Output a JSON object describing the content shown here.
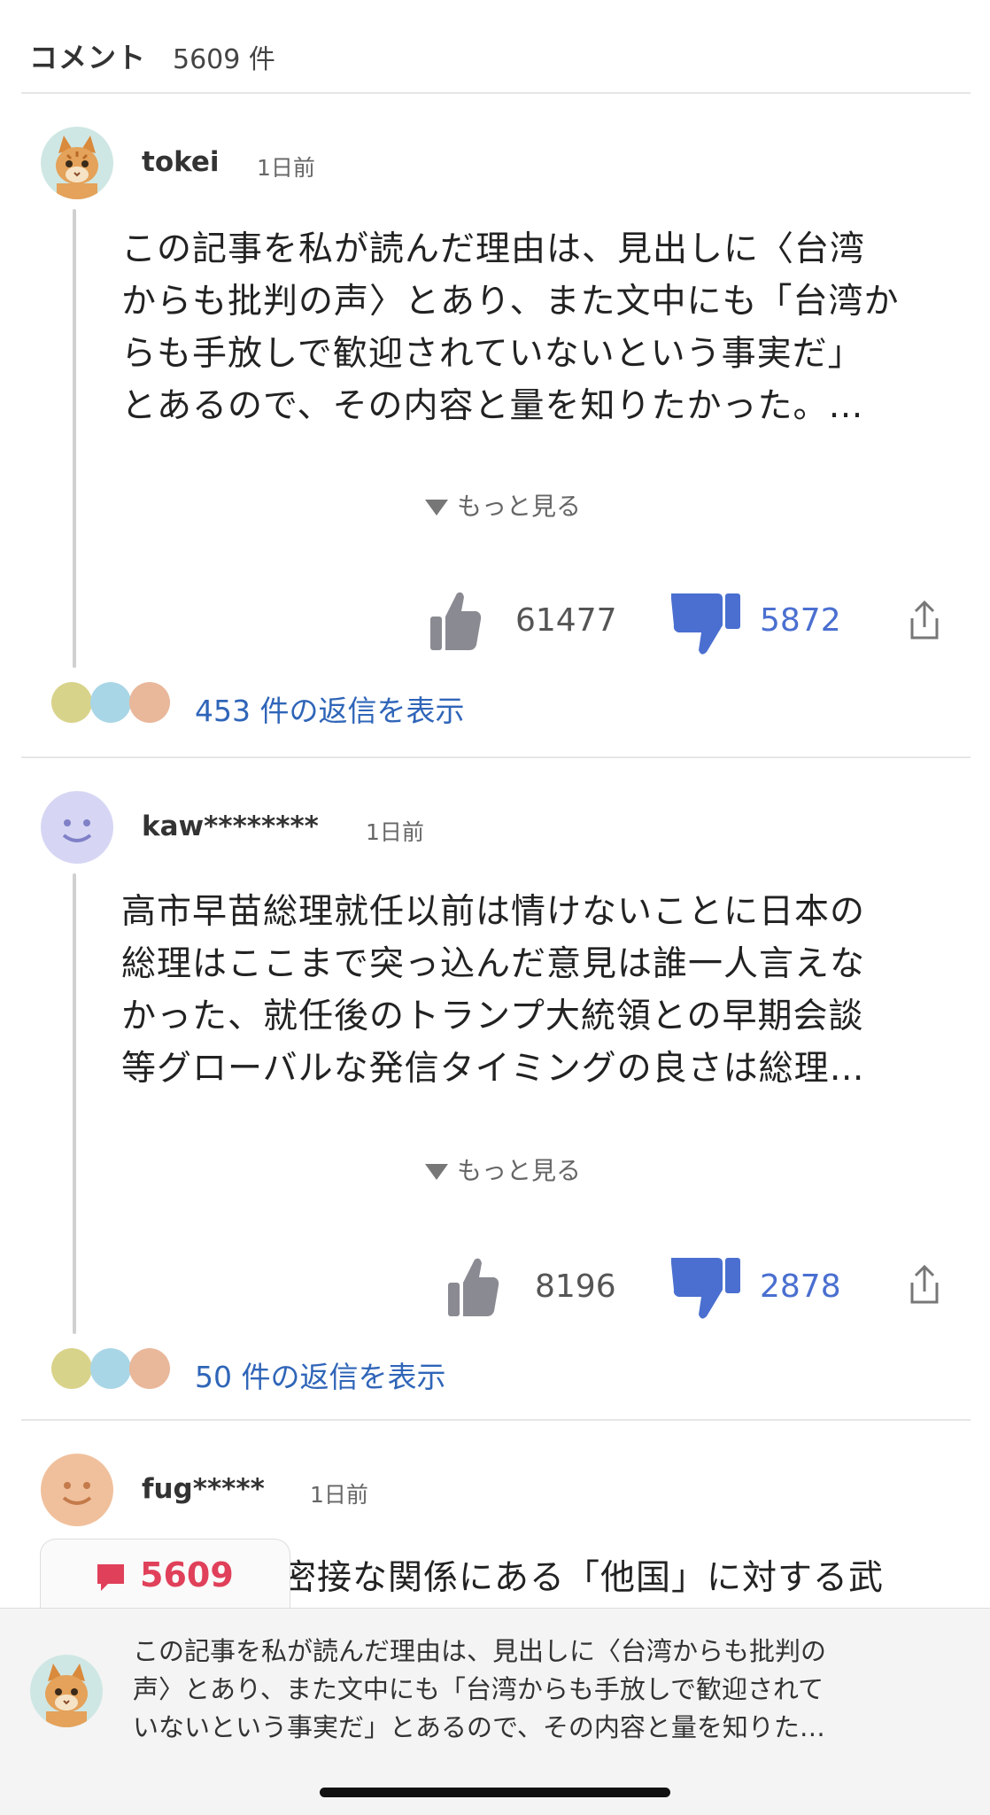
{
  "header": {
    "title": "コメント",
    "count": "5609 件"
  },
  "comments": [
    {
      "username": "tokei",
      "time": "1日前",
      "lines": [
        "この記事を私が読んだ理由は、見出しに〈台湾",
        "からも批判の声〉とあり、また文中にも「台湾か",
        "らも手放しで歓迎されていないという事実だ」",
        "とあるので、その内容と量を知りたかった。…"
      ],
      "more_label": "もっと見る",
      "likes": "61477",
      "dislikes": "5872",
      "replies_label": "453 件の返信を表示",
      "avatar_icon": "cat-avatar-icon"
    },
    {
      "username": "kaw********",
      "time": "1日前",
      "lines": [
        "高市早苗総理就任以前は情けないことに日本の",
        "総理はここまで突っ込んだ意見は誰一人言えな",
        "かった、就任後のトランプ大統領との早期会談",
        "等グローバルな発信タイミングの良さは総理…"
      ],
      "more_label": "もっと見る",
      "likes": "8196",
      "dislikes": "2878",
      "replies_label": "50 件の返信を表示",
      "avatar_icon": "smiley-avatar-icon"
    },
    {
      "username": "fug*****",
      "time": "1日前",
      "partial_line": "密接な関係にある「他国」に対する武",
      "avatar_icon": "smiley-avatar-icon"
    }
  ],
  "bottom_tab": {
    "count": "5609"
  },
  "bottom_preview": {
    "lines": [
      "この記事を私が読んだ理由は、見出しに〈台湾からも批判の",
      "声〉とあり、また文中にも「台湾からも手放しで歓迎されて",
      "いないという事実だ」とあるので、その内容と量を知りた…"
    ]
  },
  "colors": {
    "accent_blue": "#2f65b8",
    "dislike_blue": "#4a6fd0",
    "badge_red": "#e0405a"
  }
}
